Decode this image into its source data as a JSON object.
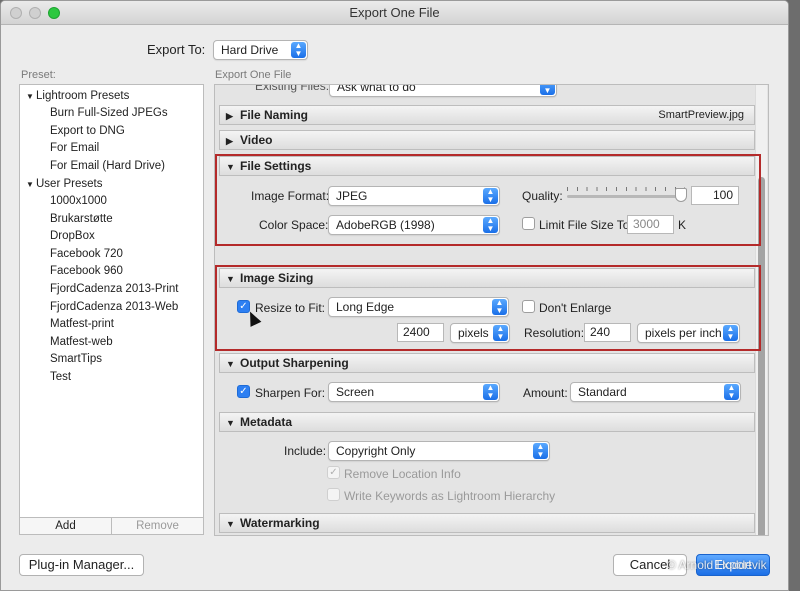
{
  "window": {
    "title": "Export One File"
  },
  "header": {
    "export_to_label": "Export To:",
    "export_to_value": "Hard Drive"
  },
  "preset": {
    "label": "Preset:",
    "groups": [
      {
        "name": "Lightroom Presets",
        "items": [
          "Burn Full-Sized JPEGs",
          "Export to DNG",
          "For Email",
          "For Email (Hard Drive)"
        ]
      },
      {
        "name": "User Presets",
        "items": [
          "1000x1000",
          "Brukarstøtte",
          "DropBox",
          "Facebook 720",
          "Facebook 960",
          "FjordCadenza 2013-Print",
          "FjordCadenza 2013-Web",
          "Matfest-print",
          "Matfest-web",
          "SmartTips",
          "Test"
        ]
      }
    ],
    "add_label": "Add",
    "remove_label": "Remove"
  },
  "main": {
    "panel_label": "Export One File",
    "existing_files_label": "Existing Files:",
    "existing_files_value": "Ask what to do",
    "sections": {
      "file_naming": {
        "title": "File Naming",
        "right_text": "SmartPreview.jpg"
      },
      "video": {
        "title": "Video"
      },
      "file_settings": {
        "title": "File Settings",
        "image_format_label": "Image Format:",
        "image_format_value": "JPEG",
        "quality_label": "Quality:",
        "quality_value": "100",
        "color_space_label": "Color Space:",
        "color_space_value": "AdobeRGB (1998)",
        "limit_size_label": "Limit File Size To:",
        "limit_size_value": "3000",
        "limit_size_unit": "K"
      },
      "image_sizing": {
        "title": "Image Sizing",
        "resize_label": "Resize to Fit:",
        "resize_value": "Long Edge",
        "dont_enlarge_label": "Don't Enlarge",
        "size_value": "2400",
        "size_unit": "pixels",
        "resolution_label": "Resolution:",
        "resolution_value": "240",
        "resolution_unit": "pixels per inch"
      },
      "output_sharpening": {
        "title": "Output Sharpening",
        "sharpen_label": "Sharpen For:",
        "sharpen_value": "Screen",
        "amount_label": "Amount:",
        "amount_value": "Standard"
      },
      "metadata": {
        "title": "Metadata",
        "include_label": "Include:",
        "include_value": "Copyright Only",
        "remove_location_label": "Remove Location Info",
        "write_keywords_label": "Write Keywords as Lightroom Hierarchy"
      },
      "watermarking": {
        "title": "Watermarking"
      }
    }
  },
  "footer": {
    "plugin_manager_label": "Plug-in Manager...",
    "cancel_label": "Cancel",
    "export_label": "Export"
  },
  "watermark_text": "© Arnold Hoddevik",
  "colors": {
    "accent": "#2d7ff2",
    "highlight": "#b42a2a"
  }
}
